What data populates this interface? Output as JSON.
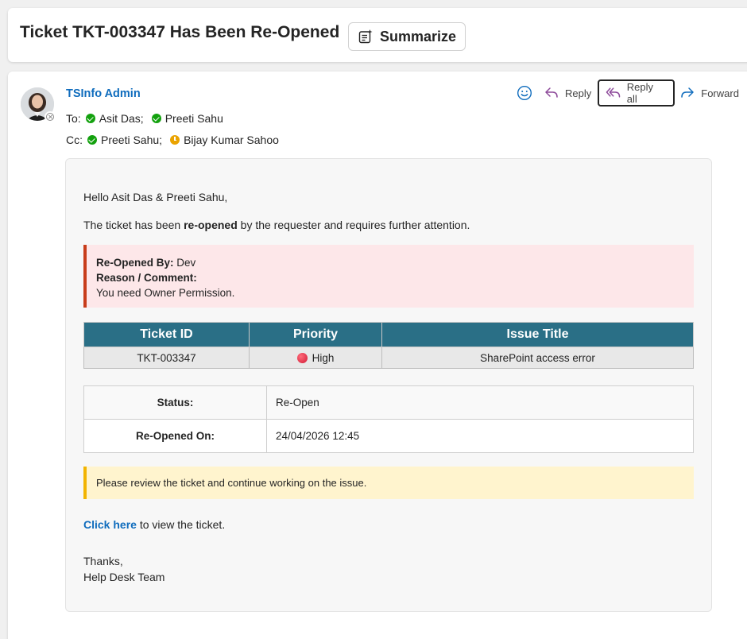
{
  "subject": {
    "title": "Ticket TKT-003347 Has Been Re-Opened",
    "summarize_label": "Summarize"
  },
  "header": {
    "sender": "TSInfo Admin",
    "to_label": "To:",
    "to": [
      "Asit Das;",
      "Preeti Sahu"
    ],
    "cc_label": "Cc:",
    "cc": [
      "Preeti Sahu;",
      "Bijay Kumar Sahoo"
    ],
    "actions": {
      "reply": "Reply",
      "reply_all": "Reply all",
      "forward": "Forward"
    }
  },
  "body": {
    "greeting": "Hello Asit Das & Preeti Sahu,",
    "intro_pre": "The ticket has been ",
    "intro_bold": "re-opened",
    "intro_post": " by the requester and requires further attention.",
    "reopened_by_label": "Re-Opened By:",
    "reopened_by_value": " Dev",
    "reason_label": "Reason / Comment:",
    "reason_value": "You need Owner Permission.",
    "table": {
      "headers": [
        "Ticket ID",
        "Priority",
        "Issue Title"
      ],
      "row": {
        "ticket_id": "TKT-003347",
        "priority": "High",
        "issue_title": "SharePoint access error"
      }
    },
    "status_label": "Status:",
    "status_value": "Re-Open",
    "reopened_on_label": "Re-Opened On:",
    "reopened_on_value": "24/04/2026 12:45",
    "notice": "Please review the ticket and continue working on the issue.",
    "link_text": "Click here",
    "link_suffix": " to view the ticket.",
    "thanks": "Thanks,",
    "team": "Help Desk Team"
  },
  "colors": {
    "accent": "#0f6cbd",
    "table_header": "#2a6f86",
    "alert_red_bg": "#fde7e9",
    "alert_red_border": "#c83c1a",
    "alert_yellow_bg": "#fff4ce",
    "alert_yellow_border": "#f2b400",
    "presence_available": "#13a10e",
    "presence_away": "#eaa300",
    "priority_high": "#d11a35"
  }
}
